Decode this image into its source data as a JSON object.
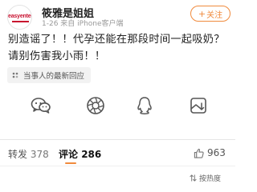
{
  "header": {
    "avatar_brand": "easyenter",
    "user_name": "筱雅是姐姐",
    "meta": "1-26 来自 iPhone客户端",
    "follow_label": "关注",
    "follow_plus": "+"
  },
  "post": {
    "text": "别造谣了！！代孕还能在那段时间一起吸奶？请别伤害我小雨！！"
  },
  "reply_chip": {
    "icon": "reply-bubble-icon",
    "label": "当事人的最新回应"
  },
  "share": {
    "items": [
      {
        "name": "wechat-icon"
      },
      {
        "name": "moments-icon"
      },
      {
        "name": "qq-icon"
      },
      {
        "name": "save-image-icon"
      }
    ]
  },
  "tabs": {
    "repost_label": "转发",
    "repost_count": "378",
    "comment_label": "评论",
    "comment_count": "286",
    "like_count": "963"
  },
  "sort": {
    "label": "按热度",
    "icon": "sort-icon"
  },
  "colors": {
    "accent": "#f08a3c",
    "text": "#222222",
    "muted": "#999999"
  }
}
